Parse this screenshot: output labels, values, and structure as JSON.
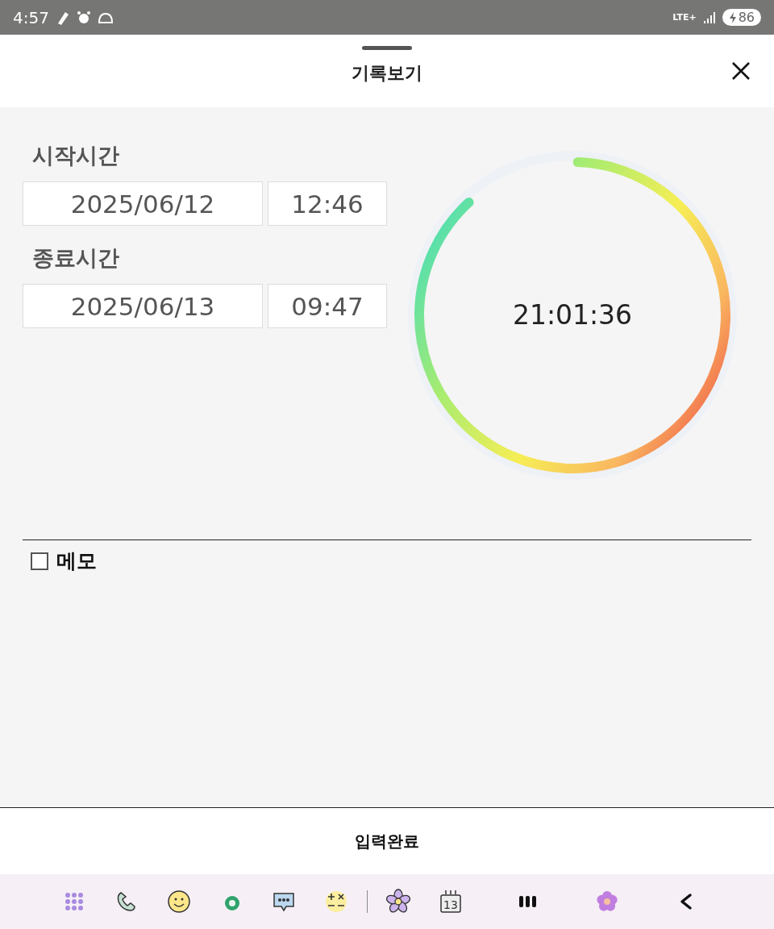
{
  "status_bar": {
    "time": "4:57",
    "network": "LTE+",
    "battery": "86"
  },
  "sheet": {
    "title": "기록보기"
  },
  "start": {
    "label": "시작시간",
    "date": "2025/06/12",
    "time": "12:46"
  },
  "end": {
    "label": "종료시간",
    "date": "2025/06/13",
    "time": "09:47"
  },
  "timer": {
    "elapsed": "21:01:36",
    "level": 0.876
  },
  "memo": {
    "label": "메모",
    "checked": false
  },
  "submit": {
    "label": "입력완료"
  },
  "nav_bar": {
    "calendar_day": "13"
  }
}
